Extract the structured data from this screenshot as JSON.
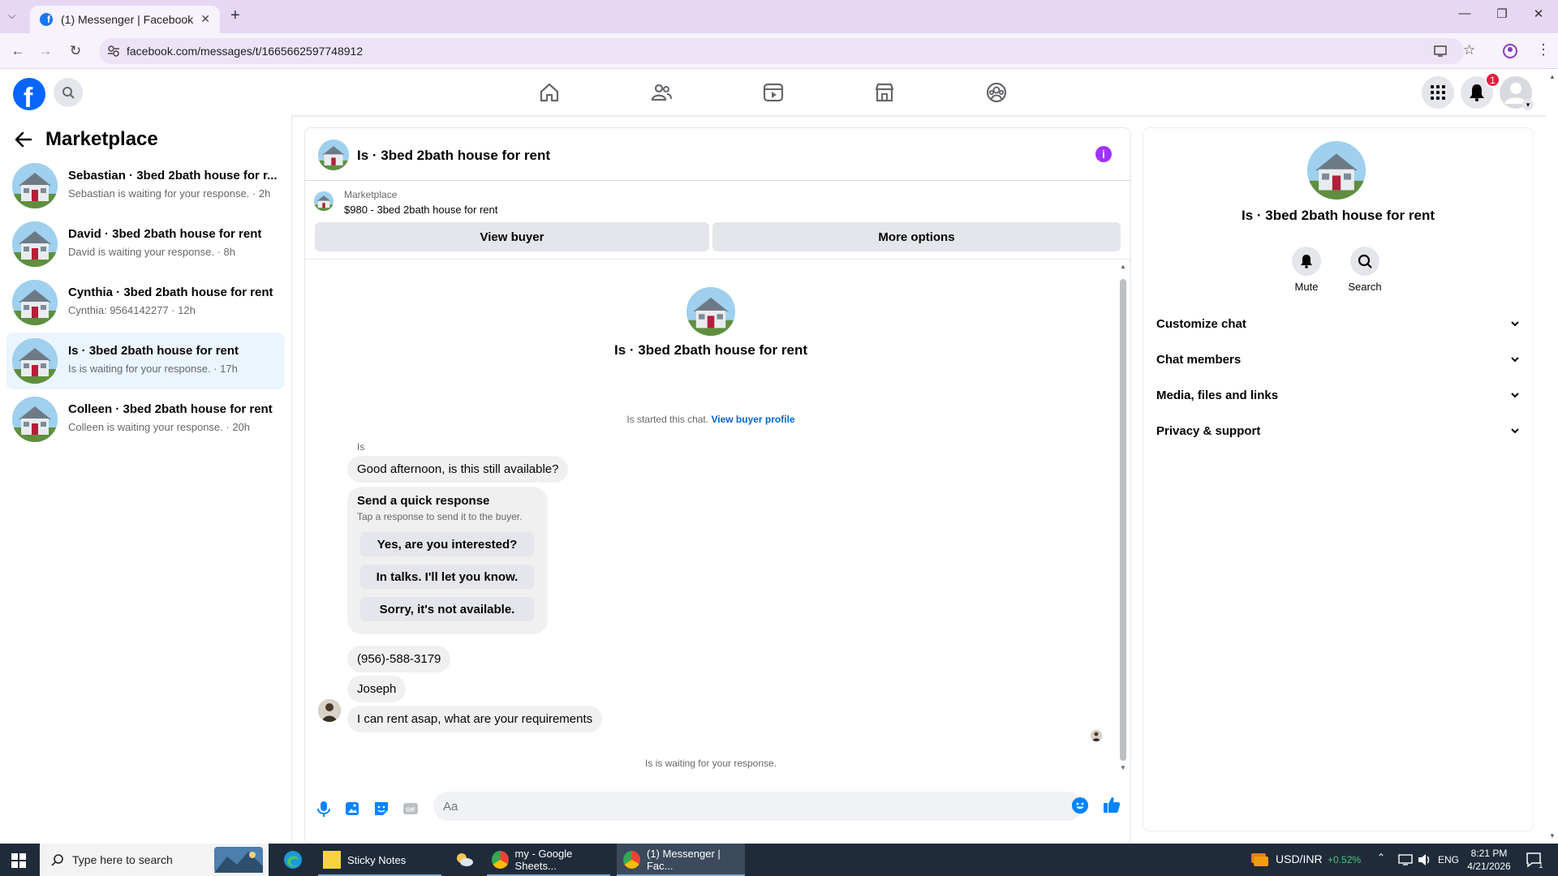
{
  "browser": {
    "tab_title": "(1) Messenger | Facebook",
    "url": "facebook.com/messages/t/1665662597748912"
  },
  "fb": {
    "notification_count": "1"
  },
  "sidebar": {
    "title": "Marketplace",
    "conversations": [
      {
        "name": "Sebastian · 3bed 2bath house for r...",
        "snippet": "Sebastian is waiting for your response. · 2h"
      },
      {
        "name": "David · 3bed 2bath house for rent",
        "snippet": "David is waiting your response. · 8h"
      },
      {
        "name": "Cynthia · 3bed 2bath house for rent",
        "snippet": "Cynthia: 9564142277 · 12h"
      },
      {
        "name": "Is · 3bed 2bath house for rent",
        "snippet": "Is is waiting for your response. · 17h"
      },
      {
        "name": "Colleen · 3bed 2bath house for rent",
        "snippet": "Colleen is waiting your response. · 20h"
      }
    ]
  },
  "chat": {
    "title": "Is · 3bed 2bath house for rent",
    "marketplace_label": "Marketplace",
    "listing": "$980 - 3bed 2bath house for rent",
    "view_buyer": "View buyer",
    "more_options": "More options",
    "started_text": "Is started this chat.",
    "view_buyer_profile": "View buyer profile",
    "sender": "Is",
    "messages": [
      "Good afternoon, is this still available?",
      "(956)-588-3179",
      "Joseph",
      "I can rent asap, what are your requirements"
    ],
    "quick_response": {
      "title": "Send a quick response",
      "subtitle": "Tap a response to send it to the buyer.",
      "options": [
        "Yes, are you interested?",
        "In talks. I'll let you know.",
        "Sorry, it's not available."
      ]
    },
    "waiting": "Is is waiting for your response.",
    "input_placeholder": "Aa"
  },
  "details": {
    "title": "Is · 3bed 2bath house for rent",
    "mute": "Mute",
    "search": "Search",
    "sections": [
      "Customize chat",
      "Chat members",
      "Media, files and links",
      "Privacy & support"
    ]
  },
  "taskbar": {
    "search_placeholder": "Type here to search",
    "apps": [
      "Sticky Notes",
      "my - Google Sheets...",
      "(1) Messenger | Fac..."
    ],
    "ticker": "USD/INR",
    "ticker_change": "+0.52%",
    "lang": "ENG",
    "time": "8:21 PM",
    "date": "4/21/2026",
    "notif_count": "1"
  },
  "colors": {
    "fb_blue": "#0866ff",
    "accent_purple": "#a033ff",
    "link": "#0064d1",
    "active_conv_bg": "#ebf5ff"
  }
}
